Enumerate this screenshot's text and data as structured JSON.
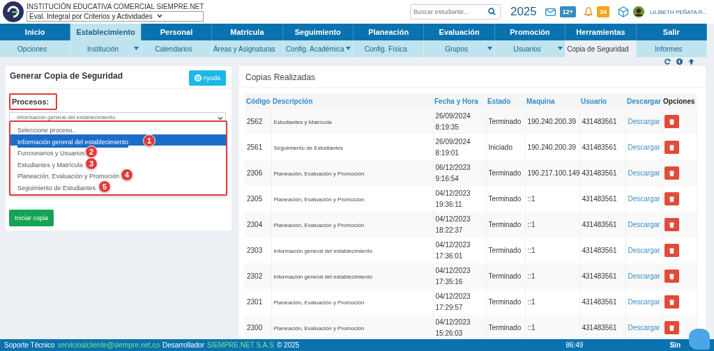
{
  "header": {
    "school_name": "INSTITUCIÓN EDUCATIVA COMERCIAL SIEMPRE.NET",
    "evaluation_select": "Eval. Integral por Criterios y Actividades",
    "search": {
      "placeholder": "Buscar estudiante..."
    },
    "year": "2025",
    "messages_badge": "12+",
    "notifications_badge": "34",
    "user_name": "LILIBETH PEÑATA R..."
  },
  "main_nav": [
    {
      "label": "Inicio",
      "selected": false
    },
    {
      "label": "Establecimiento",
      "selected": true
    },
    {
      "label": "Personal",
      "selected": false
    },
    {
      "label": "Matrícula",
      "selected": false
    },
    {
      "label": "Seguimiento",
      "selected": false
    },
    {
      "label": "Planeación",
      "selected": false
    },
    {
      "label": "Evaluación",
      "selected": false
    },
    {
      "label": "Promoción",
      "selected": false
    },
    {
      "label": "Herramientas",
      "selected": false
    },
    {
      "label": "Salir",
      "selected": false
    }
  ],
  "sub_nav": [
    {
      "label": "Opciones",
      "selected": false,
      "dropdown": false
    },
    {
      "label": "Institución",
      "selected": false,
      "dropdown": true
    },
    {
      "label": "Calendarios",
      "selected": false,
      "dropdown": false
    },
    {
      "label": "Áreas y Asignaturas",
      "selected": false,
      "dropdown": false
    },
    {
      "label": "Config. Académica",
      "selected": false,
      "dropdown": true
    },
    {
      "label": "Config. Física",
      "selected": false,
      "dropdown": false
    },
    {
      "label": "Grupos",
      "selected": false,
      "dropdown": true
    },
    {
      "label": "Usuarios",
      "selected": false,
      "dropdown": true
    },
    {
      "label": "Copia de Seguridad",
      "selected": true,
      "dropdown": false
    },
    {
      "label": "Informes",
      "selected": false,
      "dropdown": false
    }
  ],
  "backup_panel": {
    "title": "Generar Copia de Seguridad",
    "help_button": "Ayuda",
    "process_label": {
      "text": "Procesos:",
      "highlighted": true
    },
    "process_select": {
      "value": "Información general del establecimiento",
      "highlighted": true,
      "options": [
        {
          "label": "Seleccione proceso..",
          "selected": false
        },
        {
          "label": "Información general del establecimiento",
          "selected": true,
          "marker": "1"
        },
        {
          "label": "Funcionarios y Usuarios",
          "selected": false,
          "marker": "2"
        },
        {
          "label": "Estudiantes y Matrícula",
          "selected": false,
          "marker": "3"
        },
        {
          "label": "Planeación, Evaluación y Promoción",
          "selected": false,
          "marker": "4"
        },
        {
          "label": "Seguimiento de Estudiantes",
          "selected": false,
          "marker": "5"
        }
      ]
    },
    "start_button": "Iniciar copia"
  },
  "copies_panel": {
    "title": "Copias Realizadas",
    "table": {
      "columns": [
        {
          "label": "Código",
          "sortable": true
        },
        {
          "label": "Descripción",
          "sortable": true
        },
        {
          "label": "Fecha y Hora",
          "sortable": true
        },
        {
          "label": "Estado",
          "sortable": true
        },
        {
          "label": "Maquina",
          "sortable": true
        },
        {
          "label": "Usuario",
          "sortable": true
        },
        {
          "label": "Descargar",
          "sortable": true
        },
        {
          "label": "Opciones",
          "sortable": false
        }
      ],
      "rows": [
        {
          "code": "2562",
          "description": "Estudiantes y Matrícula",
          "datetime": "26/09/2024 8:19:35",
          "status": "Terminado",
          "machine": "190.240.200.39",
          "user": "431483561",
          "download": "Descargar"
        },
        {
          "code": "2561",
          "description": "Seguimiento de Estudiantes",
          "datetime": "26/09/2024 8:19:01",
          "status": "Iniciado",
          "machine": "190.240.200.39",
          "user": "431483561",
          "download": "Descargar"
        },
        {
          "code": "2306",
          "description": "Planeación, Evaluación y Promoción",
          "datetime": "06/12/2023 9:16:54",
          "status": "Terminado",
          "machine": "190.217.100.149",
          "user": "431483561",
          "download": "Descargar"
        },
        {
          "code": "2305",
          "description": "Planeación, Evaluación y Promoción",
          "datetime": "04/12/2023 19:36:11",
          "status": "Terminado",
          "machine": "::1",
          "user": "431483561",
          "download": "Descargar"
        },
        {
          "code": "2304",
          "description": "Planeación, Evaluación y Promoción",
          "datetime": "04/12/2023 18:22:37",
          "status": "Terminado",
          "machine": "::1",
          "user": "431483561",
          "download": "Descargar"
        },
        {
          "code": "2303",
          "description": "Información general del establecimiento",
          "datetime": "04/12/2023 17:36:01",
          "status": "Terminado",
          "machine": "::1",
          "user": "431483561",
          "download": "Descargar"
        },
        {
          "code": "2302",
          "description": "Información general del establecimiento",
          "datetime": "04/12/2023 17:35:16",
          "status": "Terminado",
          "machine": "::1",
          "user": "431483561",
          "download": "Descargar"
        },
        {
          "code": "2301",
          "description": "Planeación, Evaluación y Promoción",
          "datetime": "04/12/2023 17:29:57",
          "status": "Terminado",
          "machine": "::1",
          "user": "431483561",
          "download": "Descargar"
        },
        {
          "code": "2300",
          "description": "Planeación, Evaluación y Promoción",
          "datetime": "04/12/2023 15:26:03",
          "status": "Terminado",
          "machine": "::1",
          "user": "431483561",
          "download": "Descargar"
        }
      ]
    }
  },
  "footer": {
    "support_label": "Soporte Técnico",
    "support_email": "servicioalcliente@siempre.net.co",
    "developer_label": "Desarrollador",
    "developer": "SIEMPRE.NET S.A.S",
    "copyright": "© 2025",
    "timer": "86:49",
    "brand": "Sin"
  }
}
